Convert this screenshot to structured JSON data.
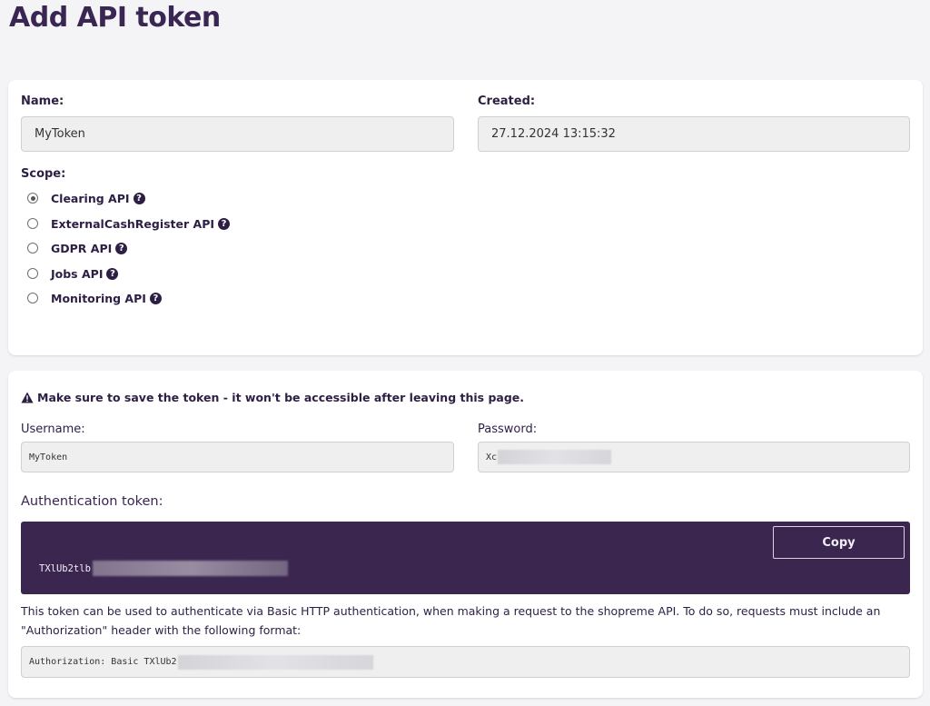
{
  "page": {
    "title": "Add API token"
  },
  "form": {
    "name_label": "Name:",
    "name_value": "MyToken",
    "created_label": "Created:",
    "created_value": "27.12.2024 13:15:32",
    "scope_label": "Scope:",
    "scopes": [
      {
        "label": "Clearing API",
        "selected": true
      },
      {
        "label": "ExternalCashRegister API",
        "selected": false
      },
      {
        "label": "GDPR API",
        "selected": false
      },
      {
        "label": "Jobs API",
        "selected": false
      },
      {
        "label": "Monitoring API",
        "selected": false
      }
    ]
  },
  "credentials": {
    "warning": "Make sure to save the token - it won't be accessible after leaving this page.",
    "username_label": "Username:",
    "username_value": "MyToken",
    "password_label": "Password:",
    "password_value_visible": "Xc",
    "auth_token_title": "Authentication token:",
    "token_visible": "TXlUb2tlb",
    "copy_label": "Copy",
    "description": "This token can be used to authenticate via Basic HTTP authentication, when making a request to the shopreme API. To do so, requests must include an \"Authorization\" header with the following format:",
    "header_example_visible": "Authorization: Basic TXlUb2"
  },
  "icons": {
    "help": "question-circle-icon",
    "warning": "warning-triangle-icon"
  },
  "colors": {
    "brand": "#3b2650",
    "text": "#2d1f44"
  }
}
